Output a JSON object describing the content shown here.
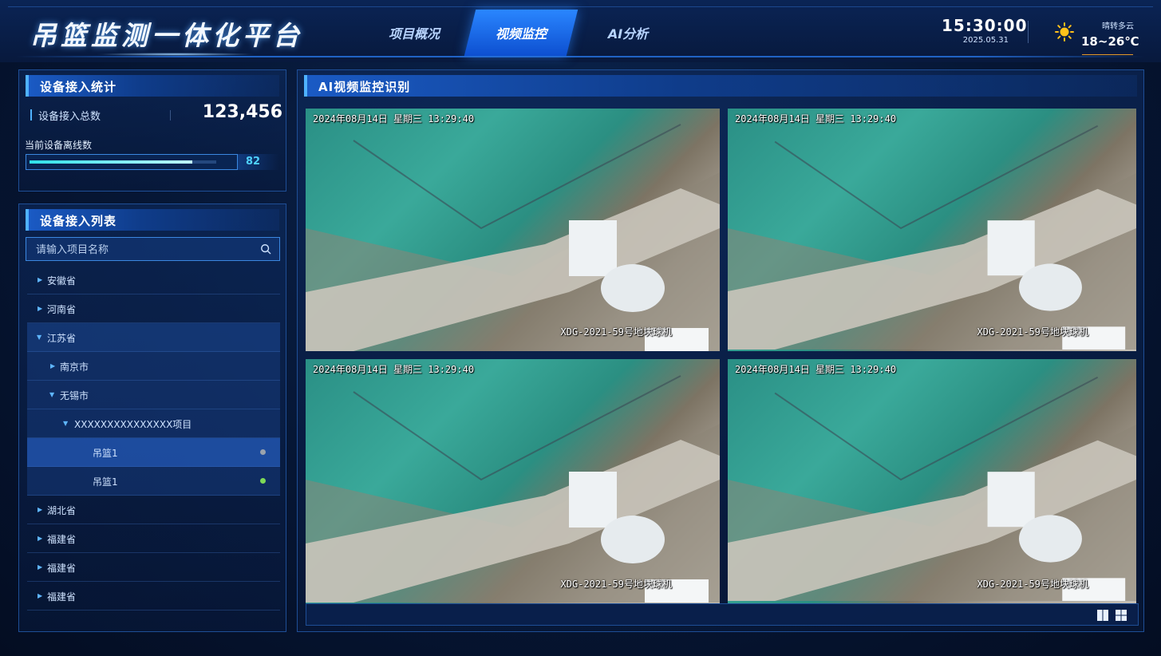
{
  "header": {
    "title": "吊篮监测一体化平台",
    "nav": [
      {
        "label": "项目概况",
        "active": false
      },
      {
        "label": "视频监控",
        "active": true
      },
      {
        "label": "AI分析",
        "active": false
      }
    ],
    "time": "15:30:00",
    "date": "2025.05.31",
    "weather_icon": "sun-icon",
    "weather_desc": "晴转多云",
    "temperature": "18~26℃"
  },
  "stats_panel": {
    "title": "设备接入统计",
    "total_label": "设备接入总数",
    "total_value": "123,456",
    "offline_label": "当前设备离线数",
    "offline_value": "82",
    "offline_progress": 0.87
  },
  "list_panel": {
    "title": "设备接入列表",
    "search_placeholder": "请输入项目名称",
    "tree": [
      {
        "label": "安徽省",
        "level": 0,
        "expanded": false
      },
      {
        "label": "河南省",
        "level": 0,
        "expanded": false
      },
      {
        "label": "江苏省",
        "level": 0,
        "expanded": true
      },
      {
        "label": "南京市",
        "level": 1,
        "expanded": false
      },
      {
        "label": "无锡市",
        "level": 1,
        "expanded": true
      },
      {
        "label": "XXXXXXXXXXXXXXX项目",
        "level": 2,
        "expanded": true
      },
      {
        "label": "吊篮1",
        "level": 3,
        "selected": true,
        "status_color": "#9aa3ad"
      },
      {
        "label": "吊篮1",
        "level": 3,
        "selected": false,
        "status_color": "#7ed957"
      },
      {
        "label": "湖北省",
        "level": 0,
        "expanded": false
      },
      {
        "label": "福建省",
        "level": 0,
        "expanded": false
      },
      {
        "label": "福建省",
        "level": 0,
        "expanded": false
      },
      {
        "label": "福建省",
        "level": 0,
        "expanded": false
      }
    ]
  },
  "video_panel": {
    "title": "AI视频监控识别",
    "cameras": [
      {
        "timestamp": "2024年08月14日  星期三  13:29:40",
        "name": "XDG-2021-59号地块球机"
      },
      {
        "timestamp": "2024年08月14日  星期三  13:29:40",
        "name": "XDG-2021-59号地块球机"
      },
      {
        "timestamp": "2024年08月14日  星期三  13:29:40",
        "name": "XDG-2021-59号地块球机"
      },
      {
        "timestamp": "2024年08月14日  星期三  13:29:40",
        "name": "XDG-2021-59号地块球机"
      }
    ],
    "layout_icons": [
      "split-2-icon",
      "grid-4-icon"
    ]
  },
  "colors": {
    "accent": "#2a86ff",
    "progress": "#2fe0e8",
    "online": "#7ed957",
    "offline": "#9aa3ad"
  }
}
